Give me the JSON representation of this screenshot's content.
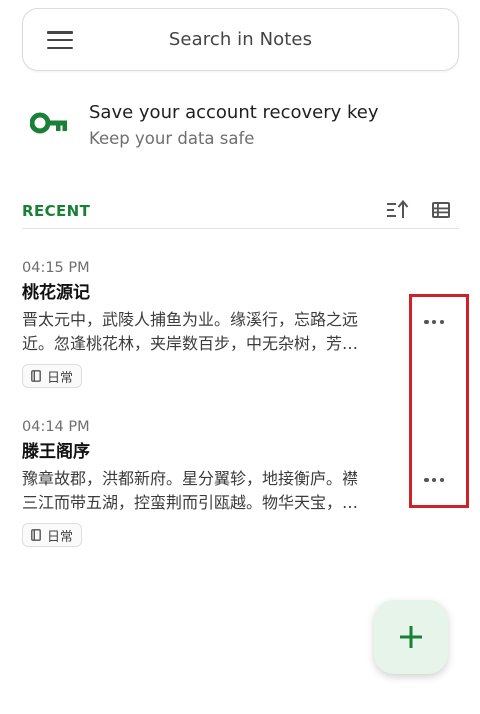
{
  "search": {
    "placeholder": "Search in Notes"
  },
  "banner": {
    "title": "Save your account recovery key",
    "subtitle": "Keep your data safe",
    "accent_color": "#1a7f37"
  },
  "recent": {
    "label": "RECENT"
  },
  "notes": [
    {
      "time": "04:15 PM",
      "title": "桃花源记",
      "snippet_line1": "晋太元中，武陵人捕鱼为业。缘溪行，忘路之远",
      "snippet_line2": "近。忽逢桃花林，夹岸数百步，中无杂树，芳…",
      "tag": "日常"
    },
    {
      "time": "04:14 PM",
      "title": "滕王阁序",
      "snippet_line1": "豫章故郡，洪都新府。星分翼轸，地接衡庐。襟",
      "snippet_line2": "三江而带五湖，控蛮荆而引瓯越。物华天宝，…",
      "tag": "日常"
    }
  ],
  "colors": {
    "highlight": "#d0202a",
    "fab_bg": "#e6f4ea",
    "fab_icon": "#1a7f37"
  }
}
